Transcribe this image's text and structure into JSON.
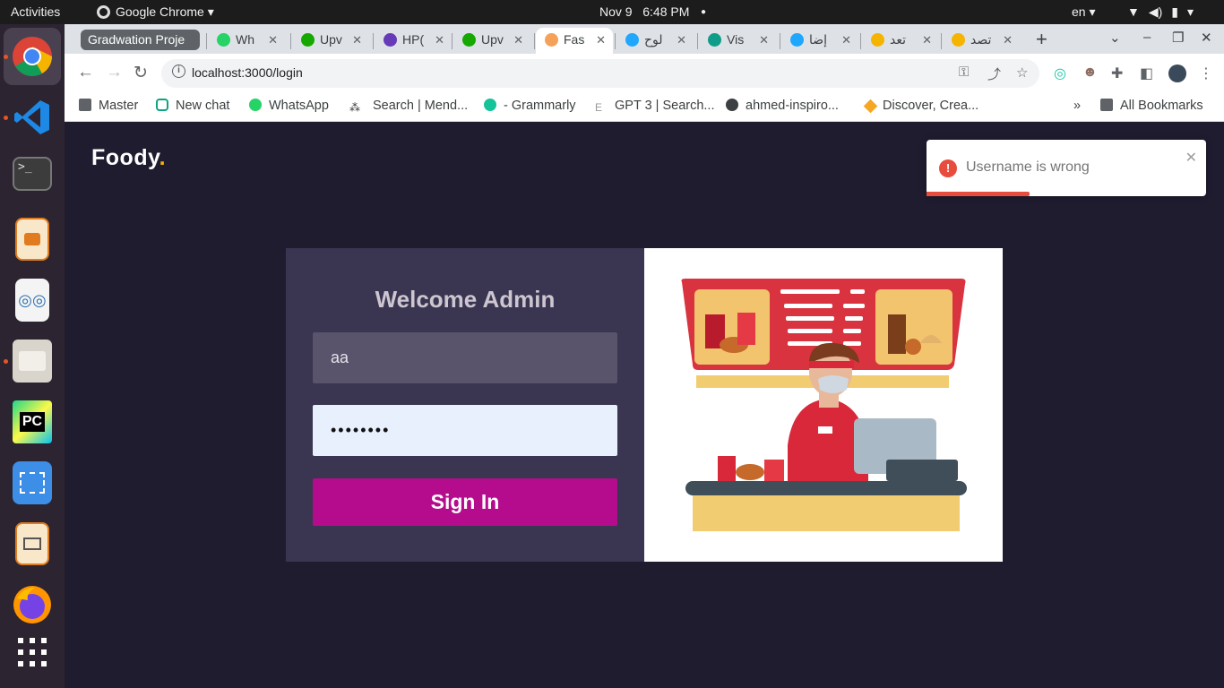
{
  "topbar": {
    "activities": "Activities",
    "app_name": "Google Chrome ▾",
    "date": "Nov 9",
    "time": "6:48 PM",
    "lang": "en ▾"
  },
  "tabs": {
    "group_label": "Gradwation Proje",
    "items": [
      {
        "label": "Wh",
        "color": "#25d366"
      },
      {
        "label": "Upv",
        "color": "#14a800"
      },
      {
        "label": "HP(",
        "color": "#673ab7"
      },
      {
        "label": "Upv",
        "color": "#14a800"
      },
      {
        "label": "Fas",
        "color": "#f4a259"
      },
      {
        "label": "لوح",
        "color": "#1ea7fd"
      },
      {
        "label": "Vis",
        "color": "#0f9d8a"
      },
      {
        "label": "إضا",
        "color": "#1ea7fd"
      },
      {
        "label": "تعد",
        "color": "#f5b400"
      },
      {
        "label": "تصد",
        "color": "#f5b400"
      }
    ],
    "active_index": 4
  },
  "toolbar": {
    "url": "localhost:3000/login"
  },
  "bookmarks": {
    "items": [
      "Master",
      "New chat",
      "WhatsApp",
      "Search | Mend...",
      "- Grammarly",
      "GPT 3 | Search...",
      "ahmed-inspiro...",
      "Discover, Crea..."
    ],
    "overflow": "»",
    "all": "All Bookmarks"
  },
  "page": {
    "logo_text": "Foody",
    "logo_dot": ".",
    "toast": {
      "message": "Username is wrong",
      "progress": 0.37
    },
    "form": {
      "title": "Welcome Admin",
      "username_value": "aa",
      "password_value": "••••••••",
      "submit_label": "Sign In"
    }
  },
  "colors": {
    "accent": "#b40c8c",
    "background": "#201c30",
    "panel": "#3a3550",
    "error": "#e74c3c",
    "logo_dot": "#f5b400"
  }
}
